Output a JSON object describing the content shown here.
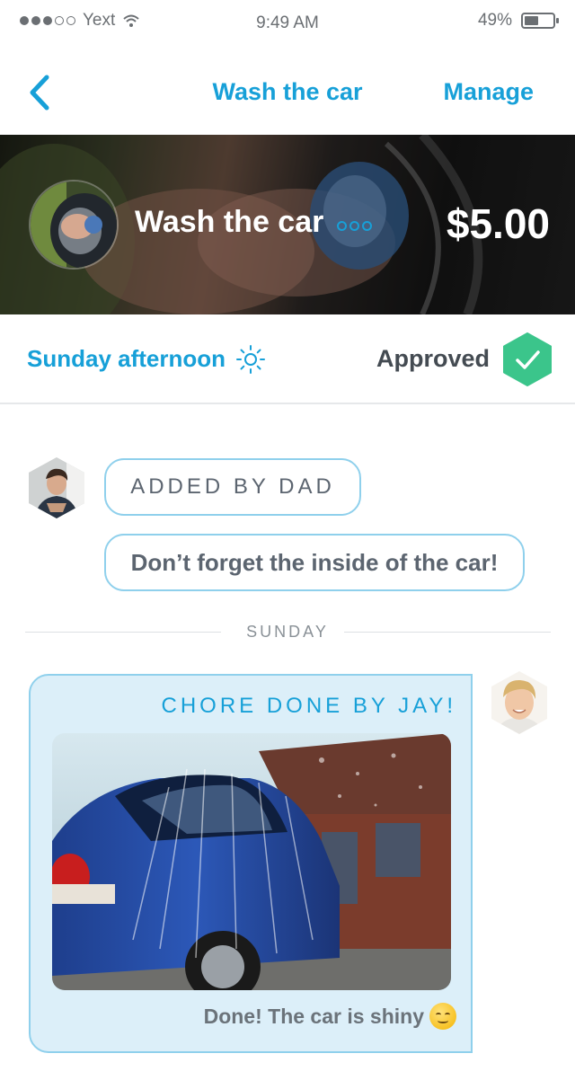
{
  "status_bar": {
    "carrier": "Yext",
    "time": "9:49 AM",
    "battery_level": "49%",
    "battery_fraction": 0.49,
    "signal_bars_filled": 3,
    "signal_bars_total": 5
  },
  "nav": {
    "back_icon": "chevron-left-icon",
    "title": "Wash the car",
    "manage_label": "Manage"
  },
  "hero": {
    "title": "Wash the car",
    "price": "$5.00",
    "more_icon": "more-icon"
  },
  "info": {
    "when": "Sunday afternoon",
    "when_icon": "sun-icon",
    "status": "Approved",
    "status_icon": "check-hex-icon"
  },
  "messages": {
    "added_by": "ADDED BY DAD",
    "note": "Don’t forget the inside of the car!",
    "day_divider": "SUNDAY",
    "done_title": "CHORE DONE BY JAY!",
    "done_caption": "Done! The car is shiny"
  },
  "colors": {
    "accent": "#17a0d8",
    "approved_green": "#3bc58b",
    "bubble_border": "#8fd0ec",
    "card_bg": "#dceff9"
  }
}
